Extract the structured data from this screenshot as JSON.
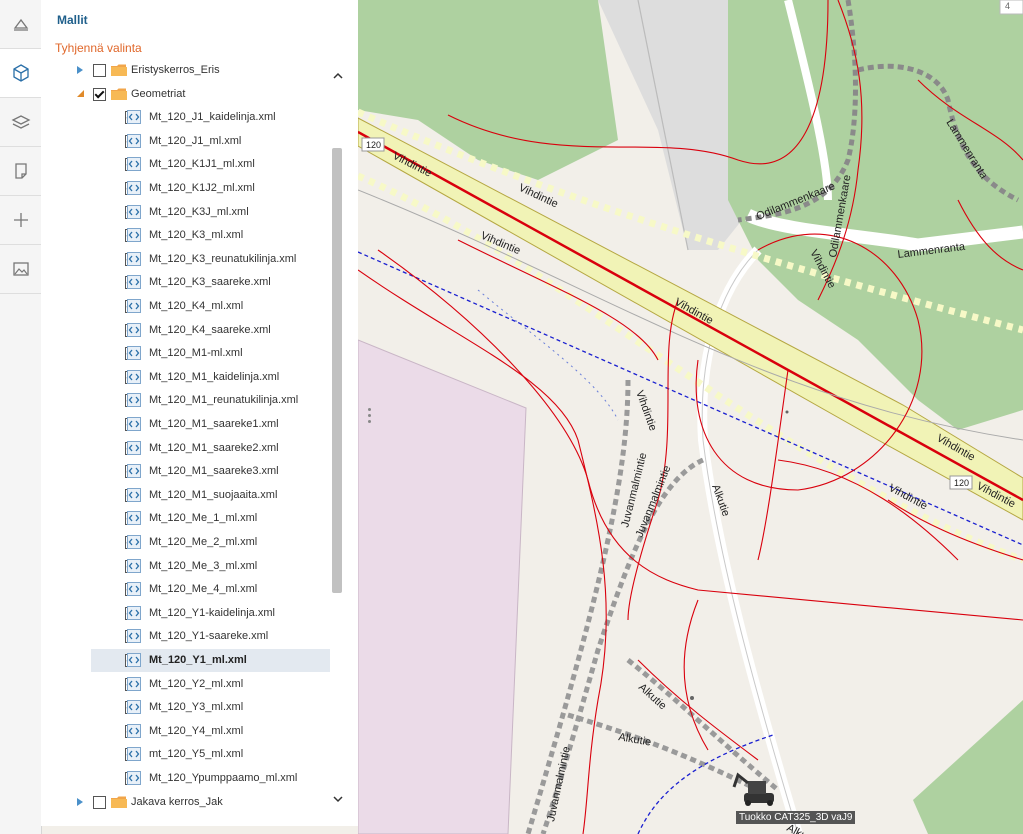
{
  "sidebar": {
    "tools": [
      {
        "name": "measure-tool-icon"
      },
      {
        "name": "models-cube-icon",
        "active": true
      },
      {
        "name": "layers-icon"
      },
      {
        "name": "note-icon"
      },
      {
        "name": "crosshair-icon"
      },
      {
        "name": "image-icon"
      }
    ]
  },
  "panel": {
    "title": "Mallit",
    "clear_label": "Tyhjennä valinta",
    "tree": [
      {
        "label": "Eristyskerros_Eris",
        "type": "folder",
        "level": 0,
        "expander": "collapsed",
        "checked": false
      },
      {
        "label": "Geometriat",
        "type": "folder",
        "level": 0,
        "expander": "expanded",
        "checked": true
      },
      {
        "label": "Mt_120_J1_kaidelinja.xml",
        "type": "file",
        "level": 1,
        "checked": true
      },
      {
        "label": "Mt_120_J1_ml.xml",
        "type": "file",
        "level": 1,
        "checked": true
      },
      {
        "label": "Mt_120_K1J1_ml.xml",
        "type": "file",
        "level": 1,
        "checked": true
      },
      {
        "label": "Mt_120_K1J2_ml.xml",
        "type": "file",
        "level": 1,
        "checked": true
      },
      {
        "label": "Mt_120_K3J_ml.xml",
        "type": "file",
        "level": 1,
        "checked": true
      },
      {
        "label": "Mt_120_K3_ml.xml",
        "type": "file",
        "level": 1,
        "checked": true
      },
      {
        "label": "Mt_120_K3_reunatukilinja.xml",
        "type": "file",
        "level": 1,
        "checked": true
      },
      {
        "label": "Mt_120_K3_saareke.xml",
        "type": "file",
        "level": 1,
        "checked": true
      },
      {
        "label": "Mt_120_K4_ml.xml",
        "type": "file",
        "level": 1,
        "checked": true
      },
      {
        "label": "Mt_120_K4_saareke.xml",
        "type": "file",
        "level": 1,
        "checked": true
      },
      {
        "label": "Mt_120_M1-ml.xml",
        "type": "file",
        "level": 1,
        "checked": true
      },
      {
        "label": "Mt_120_M1_kaidelinja.xml",
        "type": "file",
        "level": 1,
        "checked": true
      },
      {
        "label": "Mt_120_M1_reunatukilinja.xml",
        "type": "file",
        "level": 1,
        "checked": true
      },
      {
        "label": "Mt_120_M1_saareke1.xml",
        "type": "file",
        "level": 1,
        "checked": true
      },
      {
        "label": "Mt_120_M1_saareke2.xml",
        "type": "file",
        "level": 1,
        "checked": true
      },
      {
        "label": "Mt_120_M1_saareke3.xml",
        "type": "file",
        "level": 1,
        "checked": true
      },
      {
        "label": "Mt_120_M1_suojaaita.xml",
        "type": "file",
        "level": 1,
        "checked": true
      },
      {
        "label": "Mt_120_Me_1_ml.xml",
        "type": "file",
        "level": 1,
        "checked": true
      },
      {
        "label": "Mt_120_Me_2_ml.xml",
        "type": "file",
        "level": 1,
        "checked": true
      },
      {
        "label": "Mt_120_Me_3_ml.xml",
        "type": "file",
        "level": 1,
        "checked": true
      },
      {
        "label": "Mt_120_Me_4_ml.xml",
        "type": "file",
        "level": 1,
        "checked": true
      },
      {
        "label": "Mt_120_Y1-kaidelinja.xml",
        "type": "file",
        "level": 1,
        "checked": true
      },
      {
        "label": "Mt_120_Y1-saareke.xml",
        "type": "file",
        "level": 1,
        "checked": true
      },
      {
        "label": "Mt_120_Y1_ml.xml",
        "type": "file",
        "level": 1,
        "checked": true,
        "selected": true
      },
      {
        "label": "Mt_120_Y2_ml.xml",
        "type": "file",
        "level": 1,
        "checked": true
      },
      {
        "label": "Mt_120_Y3_ml.xml",
        "type": "file",
        "level": 1,
        "checked": true
      },
      {
        "label": "Mt_120_Y4_ml.xml",
        "type": "file",
        "level": 1,
        "checked": true
      },
      {
        "label": "mt_120_Y5_ml.xml",
        "type": "file",
        "level": 1,
        "checked": true
      },
      {
        "label": "Mt_120_Ypumppaamo_ml.xml",
        "type": "file",
        "level": 1,
        "checked": true
      },
      {
        "label": "Jakava kerros_Jak",
        "type": "folder",
        "level": 0,
        "expander": "collapsed",
        "checked": false
      }
    ]
  },
  "map": {
    "labels": {
      "vihdintie_1": "Vihdintie",
      "vihdintie_2": "Vihdintie",
      "vihdintie_3": "Vihdintie",
      "vihdintie_4": "Vihdintie",
      "vihdintie_5": "Vihdintie",
      "vihdintie_6": "Vihdintie",
      "vihdintie_7": "Vihdintie",
      "vihdintie_8": "Vihdintie",
      "vihdintie_9": "Vihdintie",
      "odilammenkaare_1": "Odilammenkaare",
      "odilammenkaare_2": "Odilammenkaare",
      "lammenranta_1": "Lammenranta",
      "lammenranta_2": "Lammenranta",
      "juvanmalmintie_1": "Juvanmalmintie",
      "juvanmalmintie_2": "Juvanmalmintie",
      "juvanmalmintie_3": "Juvanmalmintie",
      "alkutie_1": "Alkutie",
      "alkutie_2": "Alkutie",
      "alkutie_3": "Alkutie",
      "alkutie_4": "Alku",
      "shield_1": "120",
      "shield_2": "120",
      "corner_number": "4"
    },
    "machine_label": "Tuokko CAT325_3D vaJ9",
    "colors": {
      "green_area": "#aed1a0",
      "road_red": "#d9000d",
      "highway_fill": "#f1f3b6",
      "dashed_blue": "#1a1fd0",
      "landuse_pink": "#ebdbe8"
    }
  }
}
